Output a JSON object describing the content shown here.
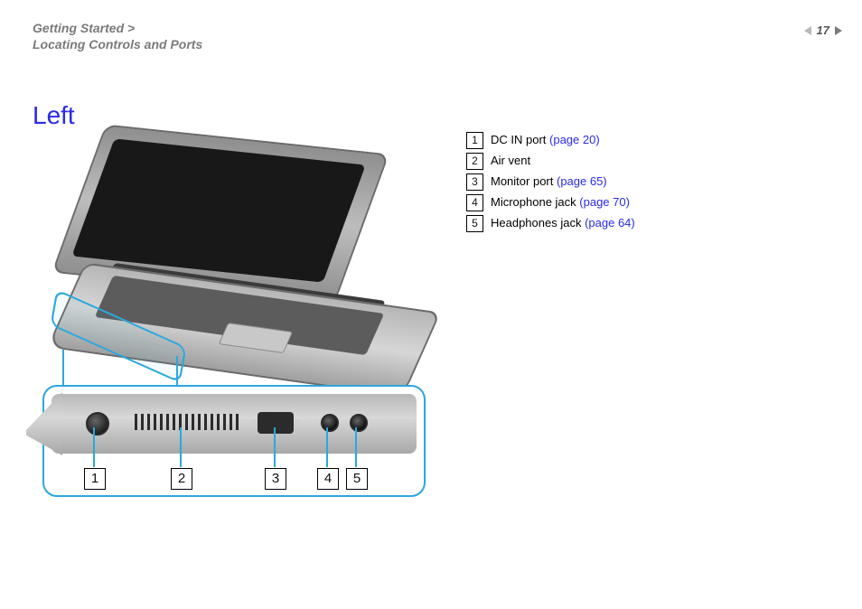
{
  "header": {
    "breadcrumb_chapter": "Getting Started >",
    "breadcrumb_section": "Locating Controls and Ports",
    "page_number": "17"
  },
  "title": "Left",
  "diagram": {
    "callouts": [
      "1",
      "2",
      "3",
      "4",
      "5"
    ]
  },
  "legend": [
    {
      "num": "1",
      "label": "DC IN port ",
      "page_ref": "(page 20)"
    },
    {
      "num": "2",
      "label": "Air vent",
      "page_ref": ""
    },
    {
      "num": "3",
      "label": "Monitor port ",
      "page_ref": "(page 65)"
    },
    {
      "num": "4",
      "label": "Microphone jack ",
      "page_ref": "(page 70)"
    },
    {
      "num": "5",
      "label": "Headphones jack ",
      "page_ref": "(page 64)"
    }
  ]
}
